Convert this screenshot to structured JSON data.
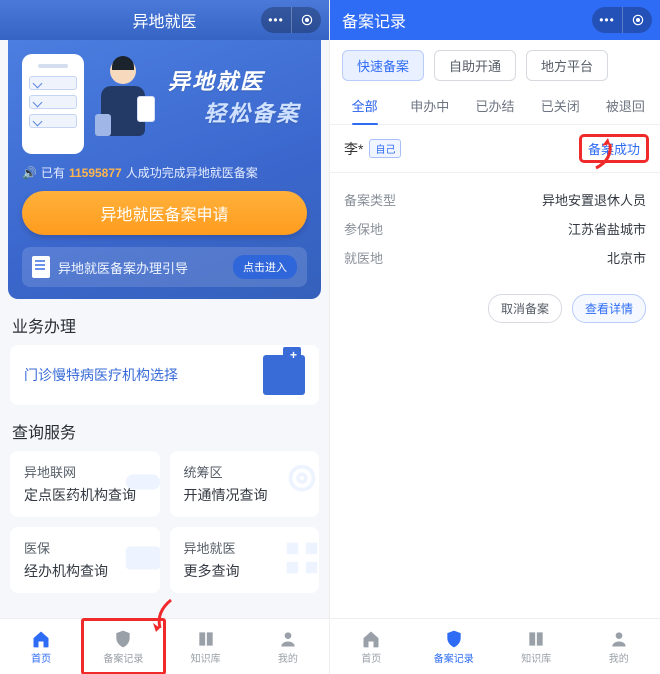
{
  "left": {
    "title": "异地就医",
    "hero": {
      "line1": "异地就医",
      "line2": "轻松备案",
      "stats_prefix": "已有",
      "stats_number": "11595877",
      "stats_suffix": "人成功完成异地就医备案",
      "cta": "异地就医备案申请",
      "guide_text": "异地就医备案办理引导",
      "guide_btn": "点击进入"
    },
    "section_business": "业务办理",
    "chronic": "门诊慢特病医疗机构选择",
    "section_query": "查询服务",
    "queries": [
      {
        "l1": "异地联网",
        "l2": "定点医药机构查询"
      },
      {
        "l1": "统筹区",
        "l2": "开通情况查询"
      },
      {
        "l1": "医保",
        "l2": "经办机构查询"
      },
      {
        "l1": "异地就医",
        "l2": "更多查询"
      }
    ],
    "tabs": [
      {
        "label": "首页",
        "icon": "home"
      },
      {
        "label": "备案记录",
        "icon": "shield"
      },
      {
        "label": "知识库",
        "icon": "book"
      },
      {
        "label": "我的",
        "icon": "user"
      }
    ],
    "active_tab": 0,
    "highlight_tab": 1
  },
  "right": {
    "title": "备案记录",
    "chips": [
      "快速备案",
      "自助开通",
      "地方平台"
    ],
    "chips_active": 0,
    "subtabs": [
      "全部",
      "申办中",
      "已办结",
      "已关闭",
      "被退回"
    ],
    "subtabs_active": 0,
    "record": {
      "name": "李*",
      "self_tag": "自己",
      "status": "备案成功",
      "rows": [
        {
          "k": "备案类型",
          "v": "异地安置退休人员"
        },
        {
          "k": "参保地",
          "v": "江苏省盐城市"
        },
        {
          "k": "就医地",
          "v": "北京市"
        }
      ],
      "actions": {
        "cancel": "取消备案",
        "detail": "查看详情"
      }
    },
    "tabs": [
      {
        "label": "首页",
        "icon": "home"
      },
      {
        "label": "备案记录",
        "icon": "shield"
      },
      {
        "label": "知识库",
        "icon": "book"
      },
      {
        "label": "我的",
        "icon": "user"
      }
    ],
    "active_tab": 1
  },
  "colors": {
    "accent": "#2f6cf5",
    "highlight": "#f02a2a",
    "cta": "#ff9c1e"
  }
}
